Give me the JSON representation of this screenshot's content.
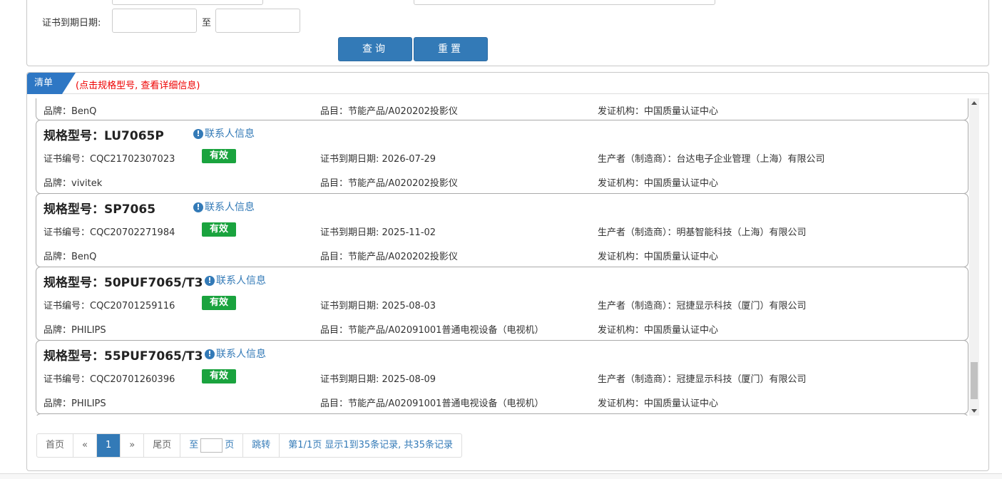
{
  "search": {
    "expiry_label": "证书到期日期:",
    "to_label": "至",
    "query_button": "查询",
    "reset_button": "重置"
  },
  "list": {
    "tab_label": "清单",
    "hint": "(点击规格型号, 查看详细信息)",
    "partial_card": {
      "brand": "品牌：BenQ",
      "category": "品目：节能产品/A020202投影仪",
      "issuer": "发证机构：中国质量认证中心"
    },
    "cards": [
      {
        "model": "规格型号：LU7065P",
        "contact": "联系人信息",
        "cert_no": "证书编号：CQC21702307023",
        "status": "有效",
        "expiry": "证书到期日期: 2026-07-29",
        "manufacturer": "生产者（制造商）：台达电子企业管理（上海）有限公司",
        "brand": "品牌：vivitek",
        "category": "品目：节能产品/A020202投影仪",
        "issuer": "发证机构：中国质量认证中心"
      },
      {
        "model": "规格型号：SP7065",
        "contact": "联系人信息",
        "cert_no": "证书编号：CQC20702271984",
        "status": "有效",
        "expiry": "证书到期日期: 2025-11-02",
        "manufacturer": "生产者（制造商）：明基智能科技（上海）有限公司",
        "brand": "品牌：BenQ",
        "category": "品目：节能产品/A020202投影仪",
        "issuer": "发证机构：中国质量认证中心"
      },
      {
        "model": "规格型号：50PUF7065/T3",
        "contact": "联系人信息",
        "cert_no": "证书编号：CQC20701259116",
        "status": "有效",
        "expiry": "证书到期日期: 2025-08-03",
        "manufacturer": "生产者（制造商）：冠捷显示科技（厦门）有限公司",
        "brand": "品牌：PHILIPS",
        "category": "品目：节能产品/A02091001普通电视设备（电视机）",
        "issuer": "发证机构：中国质量认证中心"
      },
      {
        "model": "规格型号：55PUF7065/T3",
        "contact": "联系人信息",
        "cert_no": "证书编号：CQC20701260396",
        "status": "有效",
        "expiry": "证书到期日期: 2025-08-09",
        "manufacturer": "生产者（制造商）：冠捷显示科技（厦门）有限公司",
        "brand": "品牌：PHILIPS",
        "category": "品目：节能产品/A02091001普通电视设备（电视机）",
        "issuer": "发证机构：中国质量认证中心"
      }
    ]
  },
  "pagination": {
    "first": "首页",
    "prev": "«",
    "current": "1",
    "next": "»",
    "last": "尾页",
    "goto_prefix": "至",
    "goto_suffix": "页",
    "jump": "跳转",
    "summary": "第1/1页  显示1到35条记录, 共35条记录"
  },
  "colors": {
    "primary": "#337ab7",
    "valid_badge": "#1aa33e",
    "hint_red": "#ee0000"
  }
}
